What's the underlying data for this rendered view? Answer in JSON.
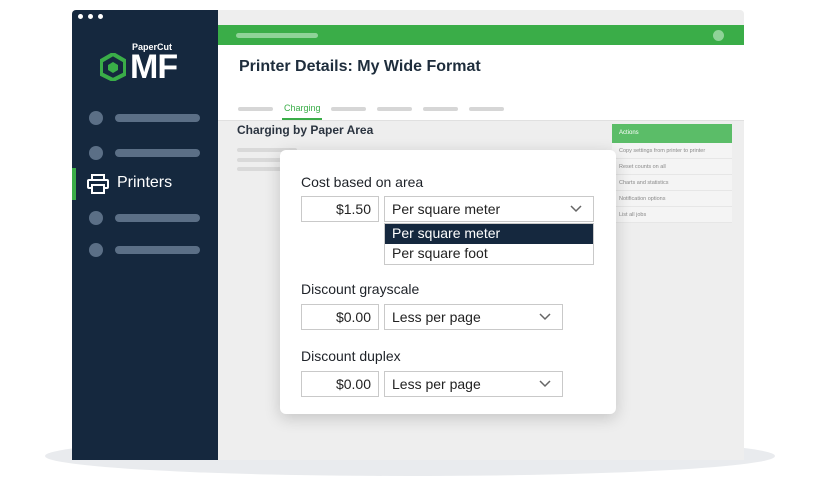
{
  "sidebar": {
    "logo_small": "PaperCut",
    "logo_big": "MF",
    "active_item": "Printers"
  },
  "header": {
    "title": "Printer Details: My Wide Format",
    "active_tab": "Charging"
  },
  "section_title": "Charging by Paper Area",
  "actions": {
    "heading": "Actions",
    "items": [
      "Copy settings from printer to printer",
      "Reset counts on all",
      "Charts and statistics",
      "Notification options",
      "List all jobs"
    ]
  },
  "card": {
    "cost": {
      "label": "Cost based on area",
      "value": "$1.50",
      "unit_selected": "Per square meter",
      "options": [
        "Per square meter",
        "Per square foot"
      ]
    },
    "discount_grayscale": {
      "label": "Discount grayscale",
      "value": "$0.00",
      "mode": "Less per page"
    },
    "discount_duplex": {
      "label": "Discount duplex",
      "value": "$0.00",
      "mode": "Less per page"
    }
  },
  "colors": {
    "brand_green": "#3aad48",
    "sidebar_navy": "#15283e",
    "dropdown_highlight": "#15283e"
  },
  "icons": [
    "papercut-logo-icon",
    "printer-icon",
    "chevron-down-icon"
  ]
}
